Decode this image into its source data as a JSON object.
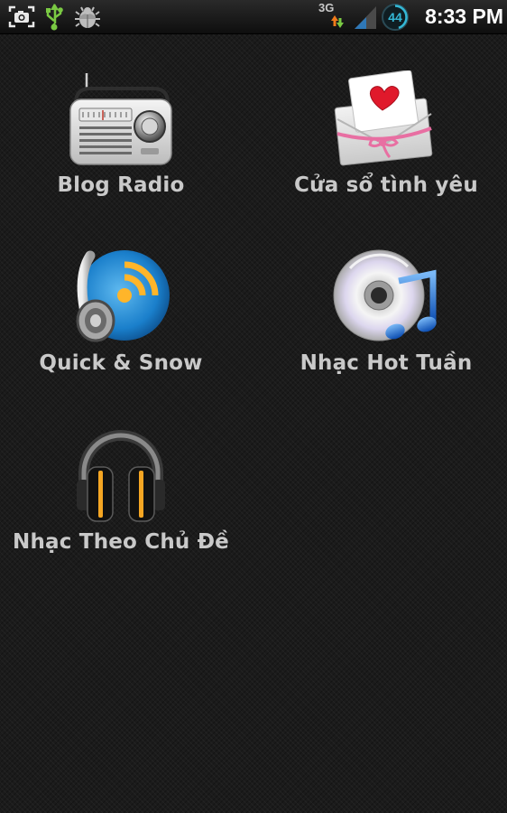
{
  "status_bar": {
    "icons": [
      "screenshot-icon",
      "usb-icon",
      "debug-icon"
    ],
    "network_type": "3G",
    "battery_level": "44",
    "time": "8:33 PM"
  },
  "apps": [
    {
      "label": "Blog Radio",
      "icon": "radio-icon"
    },
    {
      "label": "Cửa sổ tình yêu",
      "icon": "love-letter-icon"
    },
    {
      "label": "Quick & Snow",
      "icon": "headphone-wifi-icon"
    },
    {
      "label": "Nhạc Hot Tuần",
      "icon": "cd-music-icon"
    },
    {
      "label": "Nhạc Theo Chủ Đề",
      "icon": "headphones-icon"
    }
  ]
}
